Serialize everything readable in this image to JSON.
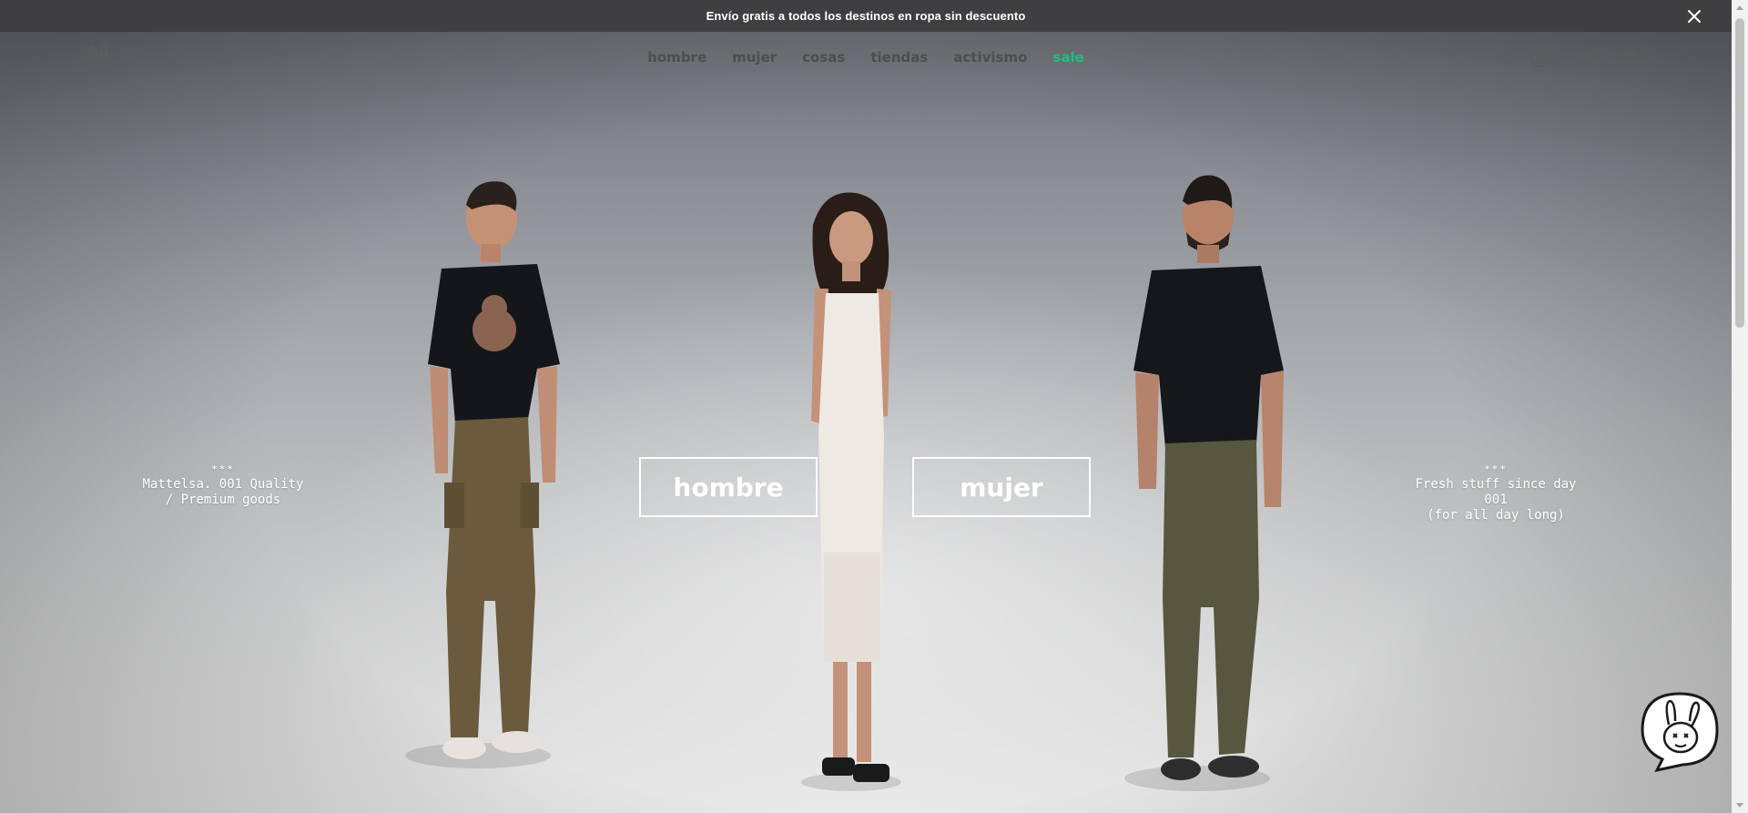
{
  "announcement": {
    "text": "Envío gratis a todos los destinos en ropa sin descuento",
    "close_icon": "close-icon"
  },
  "nav": {
    "logo_icon": "bunny-logo-icon",
    "menu": [
      {
        "label": "hombre"
      },
      {
        "label": "mujer"
      },
      {
        "label": "cosas"
      },
      {
        "label": "tiendas"
      },
      {
        "label": "activismo"
      },
      {
        "label": "sale",
        "color": "#19c17d"
      }
    ],
    "icons": [
      "account-icon",
      "search-icon",
      "bag-icon"
    ]
  },
  "hero": {
    "left_text": {
      "stars": "***",
      "line1": "Mattelsa. 001 Quality",
      "line2": "/ Premium goods"
    },
    "right_text": {
      "stars": "***",
      "line1": "Fresh stuff since day 001",
      "line2": "(for all day long)"
    },
    "cta_hombre": "hombre",
    "cta_mujer": "mujer"
  },
  "chat": {
    "icon": "bunny-chat-icon"
  },
  "colors": {
    "announcement_bg": "#3f3f41",
    "nav_text": "#4b4f4b",
    "sale": "#19c17d",
    "cta_border": "#ffffff"
  }
}
